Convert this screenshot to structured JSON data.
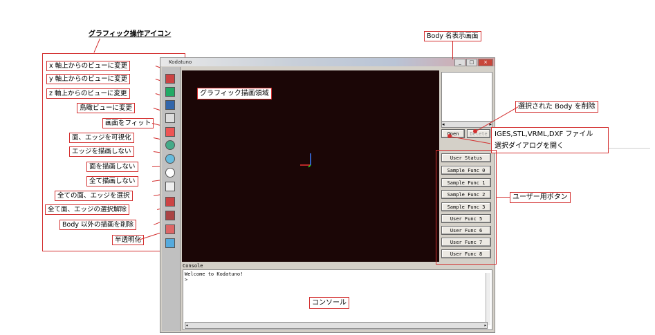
{
  "annotations": {
    "icons_title": "グラフィック操作アイコン",
    "body_area_title": "Body 名表示画面",
    "graphics_area": "グラフィック描画領域",
    "delete_body": "選択された Body を削除",
    "open_dialog_line1": "IGES,STL,VRML,DXF ファイル",
    "open_dialog_line2": "選択ダイアログを開く",
    "user_buttons": "ユーザー用ボタン",
    "console": "コンソール",
    "icon_labels": [
      "x 軸上からのビューに変更",
      "y 軸上からのビューに変更",
      "z 軸上からのビューに変更",
      "鳥瞰ビューに変更",
      "画面をフィット",
      "面、エッジを可視化",
      "エッジを描画しない",
      "面を描画しない",
      "全て描画しない",
      "全ての面、エッジを選択",
      "全て面、エッジの選択解除",
      "Body 以外の描画を削除",
      "半透明化"
    ]
  },
  "window": {
    "title": "Kodatuno",
    "open_button": "Open",
    "delete_button": "Delete",
    "user_buttons": [
      "User Status",
      "Sample Func 0",
      "Sample Func 1",
      "Sample Func 2",
      "Sample Func 3",
      "User Func 5",
      "User Func 6",
      "User Func 7",
      "User Func 8"
    ],
    "console_label": "Console",
    "console_text_line1": "Welcome to Kodatuno!",
    "console_text_line2": ">"
  },
  "colors": {
    "annotation_red": "#d32f2f",
    "canvas_background": "#1b0606"
  }
}
